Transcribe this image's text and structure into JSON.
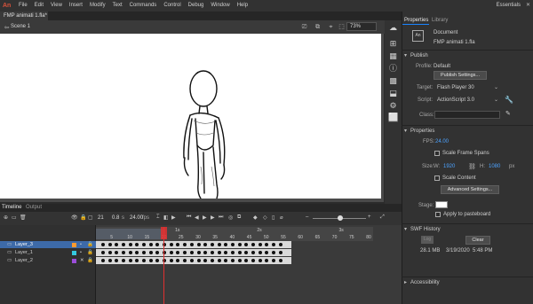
{
  "app": {
    "logo": "An"
  },
  "menu": {
    "items": [
      "File",
      "Edit",
      "View",
      "Insert",
      "Modify",
      "Text",
      "Commands",
      "Control",
      "Debug",
      "Window",
      "Help"
    ],
    "workspace": "Essentials",
    "close": "✕"
  },
  "document": {
    "tab": "FMP animati 1.fla*",
    "scene": "Scene 1",
    "zoom": "73%"
  },
  "panel": {
    "tabs": {
      "properties": "Properties",
      "library": "Library"
    },
    "doc_label": "Document",
    "doc_name": "FMP animati 1.fla",
    "publish": {
      "heading": "Publish",
      "profile_label": "Profile:",
      "profile_value": "Default",
      "settings_button": "Publish Settings...",
      "target_label": "Target:",
      "target_value": "Flash Player 30",
      "script_label": "Script:",
      "script_value": "ActionScript 3.0",
      "class_label": "Class:"
    },
    "properties": {
      "heading": "Properties",
      "fps_label": "FPS:",
      "fps_value": "24.00",
      "scale_spans": "Scale Frame Spans",
      "size_label": "Size:",
      "w_label": "W:",
      "w_value": "1920",
      "h_label": "H:",
      "h_value": "1080",
      "px": "px",
      "scale_content": "Scale Content",
      "advanced_button": "Advanced Settings...",
      "stage_label": "Stage:",
      "stage_color": "#ffffff",
      "apply_pasteboard": "Apply to pasteboard"
    },
    "swf_history": {
      "heading": "SWF History",
      "log_button": "Log",
      "clear_button": "Clear",
      "size": "28.1 MB",
      "date": "3/19/2020",
      "time": "5:48 PM"
    },
    "accessibility": "Accessibility"
  },
  "timeline": {
    "tabs": {
      "timeline": "Timeline",
      "output": "Output"
    },
    "current_frame": "21",
    "time": "0.8",
    "time_unit": "s",
    "fps": "24.00",
    "fps_unit": "fps",
    "ruler_ticks": [
      "5",
      "10",
      "15",
      "20",
      "25",
      "30",
      "35",
      "40",
      "45",
      "50",
      "55",
      "60",
      "65",
      "70",
      "75",
      "80"
    ],
    "second_marks": [
      "1s",
      "2s",
      "3s"
    ],
    "layers": [
      {
        "name": "Layer_3",
        "color": "#ff9a2e",
        "selected": true
      },
      {
        "name": "Layer_1",
        "color": "#35c8e0",
        "selected": false
      },
      {
        "name": "Layer_2",
        "color": "#9b4dd8",
        "selected": false
      }
    ]
  }
}
